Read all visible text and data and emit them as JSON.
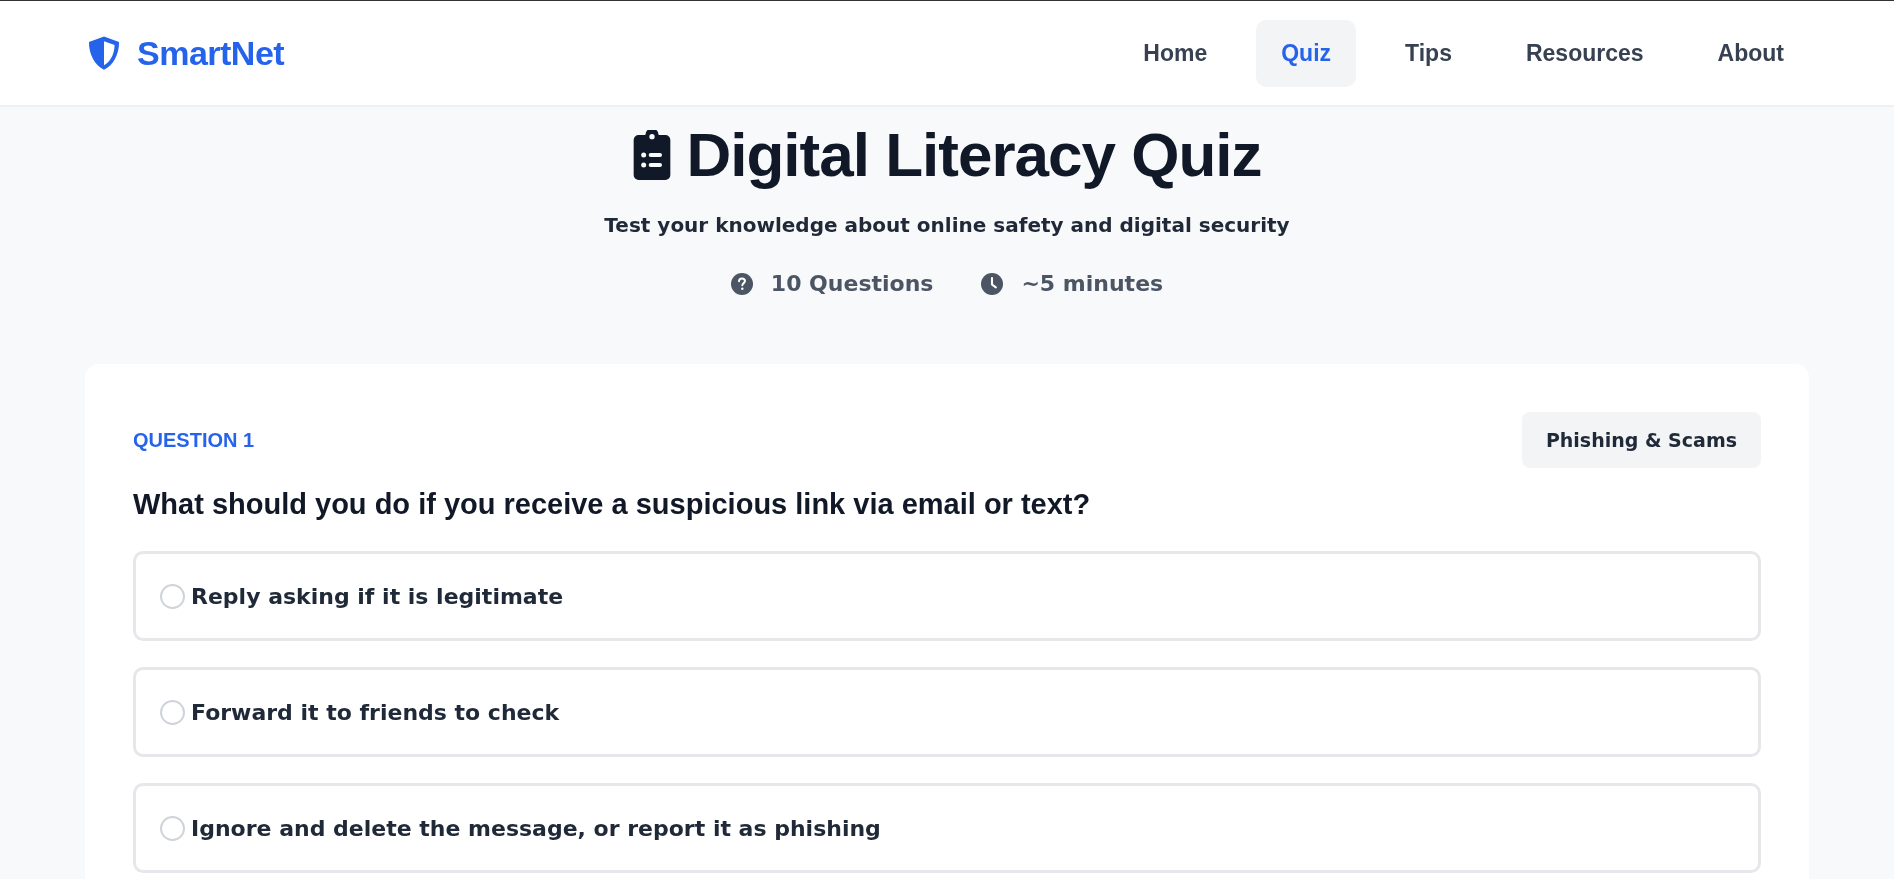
{
  "header": {
    "brand": "SmartNet",
    "nav": [
      {
        "label": "Home",
        "selected": false
      },
      {
        "label": "Quiz",
        "selected": true
      },
      {
        "label": "Tips",
        "selected": false
      },
      {
        "label": "Resources",
        "selected": false
      },
      {
        "label": "About",
        "selected": false
      }
    ]
  },
  "hero": {
    "title": "Digital Literacy Quiz",
    "subtitle": "Test your knowledge about online safety and digital security",
    "meta": [
      {
        "kind": "questions",
        "text": "10 Questions"
      },
      {
        "kind": "time",
        "text": "~5 minutes"
      }
    ]
  },
  "question": {
    "number": "QUESTION 1",
    "category": "Phishing & Scams",
    "text": "What should you do if you receive a suspicious link via email or text?",
    "options": [
      {
        "text": "Reply asking if it is legitimate",
        "selected": false
      },
      {
        "text": "Forward it to friends to check",
        "selected": false
      },
      {
        "text": "Ignore and delete the message, or report it as phishing",
        "selected": false
      }
    ]
  }
}
